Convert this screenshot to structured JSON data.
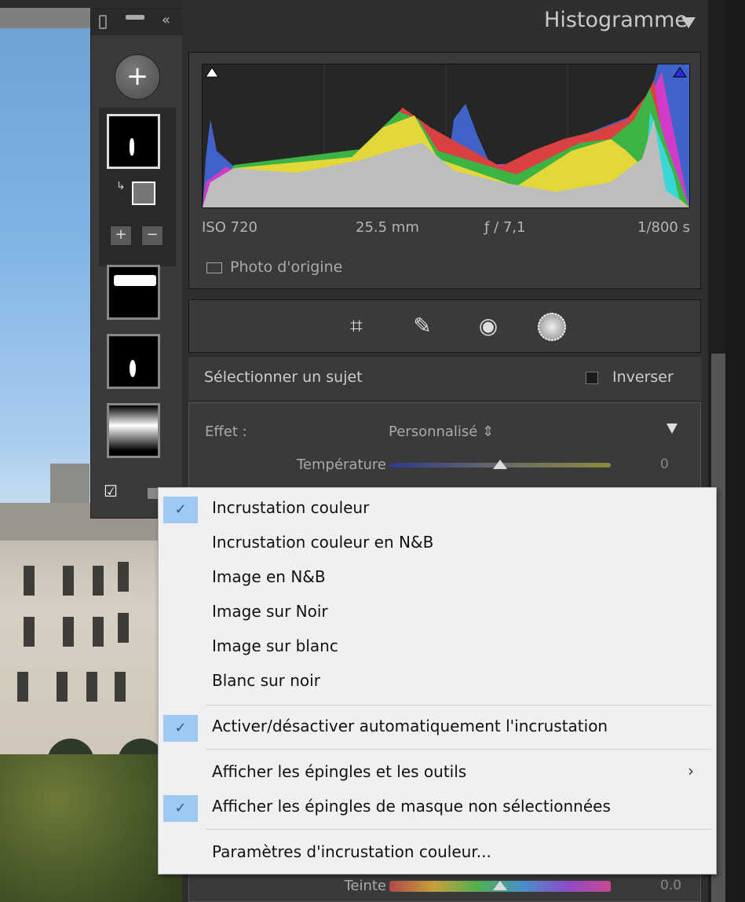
{
  "histogram": {
    "title": "Histogramme",
    "iso": "ISO 720",
    "focal": "25.5 mm",
    "aperture": "ƒ / 7,1",
    "shutter": "1/800 s",
    "original_photo_label": "Photo d'origine"
  },
  "toolbar": {
    "icons": [
      "crop-icon",
      "healing-icon",
      "red-eye-icon",
      "mask-icon"
    ]
  },
  "mask": {
    "select_subject": "Sélectionner un sujet",
    "invert": "Inverser",
    "effect_label": "Effet :",
    "effect_value": "Personnalisé ⇕"
  },
  "sliders": {
    "temperature": {
      "label": "Température",
      "value": "0",
      "level": 0.5
    },
    "tint": {
      "label": "Teinte",
      "value": "0.0",
      "level": 0.5
    }
  },
  "context_menu": {
    "items": [
      {
        "label": "Incrustation couleur",
        "checked": true
      },
      {
        "label": "Incrustation couleur en N&B",
        "checked": false
      },
      {
        "label": "Image en N&B",
        "checked": false
      },
      {
        "label": "Image sur Noir",
        "checked": false
      },
      {
        "label": "Image sur blanc",
        "checked": false
      },
      {
        "label": "Blanc sur noir",
        "checked": false
      },
      {
        "label": "Activer/désactiver automatiquement l'incrustation",
        "checked": true
      },
      {
        "label": "Afficher les épingles et les outils",
        "checked": false,
        "submenu": true
      },
      {
        "label": "Afficher les épingles de masque non sélectionnées",
        "checked": true
      },
      {
        "label": "Paramètres d'incrustation couleur...",
        "checked": false
      }
    ],
    "check_glyph": "✓",
    "submenu_glyph": "›"
  },
  "colors": {
    "accent_check": "#9ccaf0",
    "panel": "#3a3a3a"
  }
}
